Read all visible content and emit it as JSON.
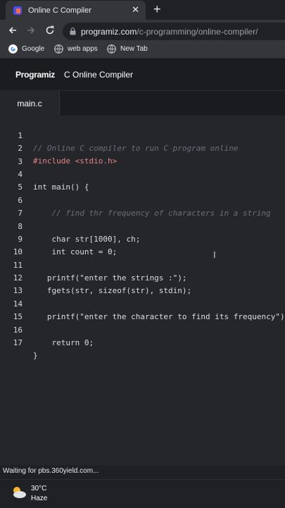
{
  "browser": {
    "tab_title": "Online C Compiler",
    "url_host": "programiz.com",
    "url_path": "/c-programming/online-compiler/",
    "bookmarks": [
      {
        "label": "Google"
      },
      {
        "label": "web apps"
      },
      {
        "label": "New Tab"
      }
    ]
  },
  "site": {
    "logo": "Programiz",
    "title": "C Online Compiler"
  },
  "editor": {
    "file_name": "main.c",
    "lines": [
      {
        "n": "1",
        "code": "// Online C compiler to run C program online"
      },
      {
        "n": "2",
        "code": "#include <stdio.h>"
      },
      {
        "n": "3",
        "code": ""
      },
      {
        "n": "4",
        "code": "int main() {"
      },
      {
        "n": "5",
        "code": ""
      },
      {
        "n": "6",
        "code": "    // find thr frequency of characters in a string"
      },
      {
        "n": "7",
        "code": ""
      },
      {
        "n": "8",
        "code": "    char str[1000], ch;"
      },
      {
        "n": "9",
        "code": "    int count = 0;"
      },
      {
        "n": "10",
        "code": ""
      },
      {
        "n": "11",
        "code": "   printf(\"enter the strings :\");"
      },
      {
        "n": "12",
        "code": "   fgets(str, sizeof(str), stdin);"
      },
      {
        "n": "13",
        "code": ""
      },
      {
        "n": "14",
        "code": "   printf(\"enter the character to find its frequency\");"
      },
      {
        "n": "15",
        "code": ""
      },
      {
        "n": "16",
        "code": "    return 0;"
      },
      {
        "n": "17",
        "code": "}"
      }
    ]
  },
  "status": {
    "text": "Waiting for pbs.360yield.com..."
  },
  "taskbar": {
    "temperature": "30°C",
    "condition": "Haze"
  },
  "colors": {
    "accent": "#8ab4f8",
    "editor_bg": "#25262a",
    "comment": "#6b6e78",
    "number": "#e8886c"
  }
}
